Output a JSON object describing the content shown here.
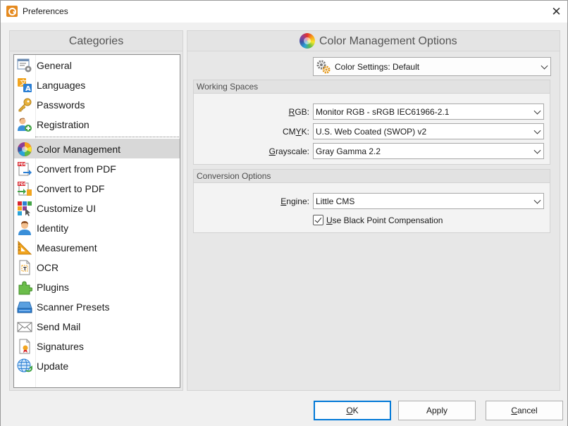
{
  "window": {
    "title": "Preferences",
    "close_glyph": "✕"
  },
  "categories": {
    "header": "Categories",
    "items": [
      {
        "label": "General",
        "icon": "general-settings-icon"
      },
      {
        "label": "Languages",
        "icon": "languages-icon"
      },
      {
        "label": "Passwords",
        "icon": "key-icon"
      },
      {
        "label": "Registration",
        "icon": "user-add-icon"
      },
      {
        "label": "Color Management",
        "icon": "color-wheel-icon",
        "selected": true
      },
      {
        "label": "Convert from PDF",
        "icon": "pdf-export-icon"
      },
      {
        "label": "Convert to PDF",
        "icon": "pdf-import-icon"
      },
      {
        "label": "Customize UI",
        "icon": "customize-ui-icon"
      },
      {
        "label": "Identity",
        "icon": "identity-icon"
      },
      {
        "label": "Measurement",
        "icon": "ruler-triangle-icon"
      },
      {
        "label": "OCR",
        "icon": "ocr-icon"
      },
      {
        "label": "Plugins",
        "icon": "puzzle-icon"
      },
      {
        "label": "Scanner Presets",
        "icon": "scanner-icon"
      },
      {
        "label": "Send Mail",
        "icon": "envelope-icon"
      },
      {
        "label": "Signatures",
        "icon": "signature-icon"
      },
      {
        "label": "Update",
        "icon": "globe-update-icon"
      }
    ]
  },
  "color_management": {
    "header": "Color Management Options",
    "color_settings": {
      "label": "Color Settings:",
      "value": "Default"
    },
    "working_spaces": {
      "title": "Working Spaces",
      "rgb": {
        "label_pre": "",
        "label_u": "R",
        "label_post": "GB:",
        "value": "Monitor RGB - sRGB IEC61966-2.1"
      },
      "cmyk": {
        "label_pre": "CM",
        "label_u": "Y",
        "label_post": "K:",
        "value": "U.S. Web Coated (SWOP) v2"
      },
      "grayscale": {
        "label_pre": "",
        "label_u": "G",
        "label_post": "rayscale:",
        "value": "Gray Gamma 2.2"
      }
    },
    "conversion_options": {
      "title": "Conversion Options",
      "engine": {
        "label_pre": "",
        "label_u": "E",
        "label_post": "ngine:",
        "value": "Little CMS"
      },
      "black_point": {
        "label_pre": "",
        "label_u": "U",
        "label_post": "se Black Point Compensation",
        "checked": true
      }
    }
  },
  "buttons": {
    "ok": {
      "pre": "",
      "u": "O",
      "post": "K"
    },
    "apply": {
      "pre": "",
      "u": "",
      "post": "Apply"
    },
    "cancel": {
      "pre": "",
      "u": "C",
      "post": "ancel"
    }
  }
}
